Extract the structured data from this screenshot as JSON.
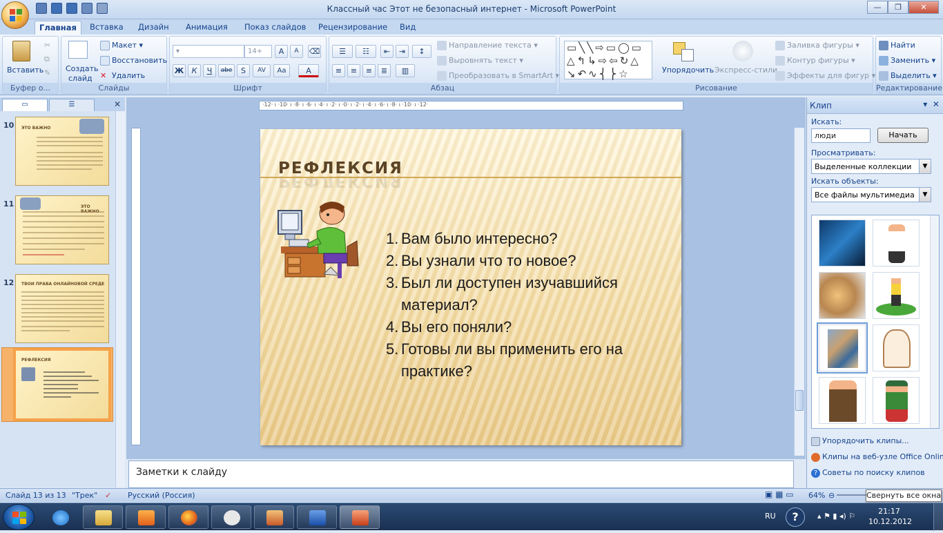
{
  "window": {
    "title": "Классный час Этот не безопасный интернет - Microsoft PowerPoint"
  },
  "tabs": [
    "Главная",
    "Вставка",
    "Дизайн",
    "Анимация",
    "Показ слайдов",
    "Рецензирование",
    "Вид"
  ],
  "ribbon": {
    "clipboard": {
      "paste": "Вставить",
      "group": "Буфер о..."
    },
    "slides": {
      "new_slide": "Создать",
      "new_slide2": "слайд",
      "layout": "Макет",
      "reset": "Восстановить",
      "delete": "Удалить",
      "group": "Слайды"
    },
    "font": {
      "size": "14+",
      "group": "Шрифт",
      "bold": "Ж",
      "italic": "К",
      "underline": "Ч",
      "strike": "abe",
      "shadow": "S",
      "spacing": "AV",
      "case": "Aa",
      "grow": "A",
      "shrink": "A",
      "color": "A"
    },
    "paragraph": {
      "text_dir": "Направление текста",
      "align_text": "Выровнять текст",
      "smartart": "Преобразовать в SmartArt",
      "group": "Абзац"
    },
    "drawing": {
      "arrange": "Упорядочить",
      "quick_styles": "Экспресс-стили",
      "fill": "Заливка фигуры",
      "outline": "Контур фигуры",
      "effects": "Эффекты для фигур",
      "group": "Рисование"
    },
    "editing": {
      "find": "Найти",
      "replace": "Заменить",
      "select": "Выделить",
      "group": "Редактирование"
    }
  },
  "ruler": {
    "labels": "·12· ı ·10· ı ·8· ı ·6· ı ·4· ı ·2· ı ·0· ı ·2· ı ·4· ı ·6· ı ·8· ı ·10· ı ·12·"
  },
  "thumbnails": [
    {
      "num": "10",
      "title": "ЭТО ВАЖНО"
    },
    {
      "num": "11",
      "title": "ЭТО ВАЖНО"
    },
    {
      "num": "12",
      "title": "ТВОИ ПРАВА ОНЛАЙНОВОЙ СРЕДЕ"
    },
    {
      "num": "13",
      "title": "РЕФЛЕКСИЯ"
    }
  ],
  "slide": {
    "title": "РЕФЛЕКСИЯ",
    "items": [
      {
        "n": "1.",
        "t": "Вам было интересно?"
      },
      {
        "n": "2.",
        "t": "Вы узнали что то новое?"
      },
      {
        "n": "3.",
        "t": "Был ли доступен изучавшийся материал?"
      },
      {
        "n": "4.",
        "t": "Вы его поняли?"
      },
      {
        "n": "5.",
        "t": "Готовы ли вы применить его на практике?"
      }
    ]
  },
  "notes": {
    "placeholder": "Заметки к слайду"
  },
  "taskpane": {
    "title": "Клип",
    "search_label": "Искать:",
    "search_value": "люди",
    "go_button": "Начать",
    "browse_label": "Просматривать:",
    "browse_value": "Выделенные коллекции",
    "objects_label": "Искать объекты:",
    "objects_value": "Все файлы мультимедиа",
    "links": [
      "Упорядочить клипы...",
      "Клипы на веб-узле Office Online",
      "Советы по поиску клипов"
    ]
  },
  "status": {
    "slide": "Слайд 13 из 13",
    "theme": "\"Трек\"",
    "lang": "Русский (Россия)",
    "zoom": "64%",
    "tooltip": "Свернуть все окна"
  },
  "tray": {
    "lang": "RU",
    "time": "21:17",
    "date": "10.12.2012"
  },
  "colors": {
    "accent": "#15428b",
    "slide_title": "#5b4326",
    "selection": "#f5a24a"
  }
}
